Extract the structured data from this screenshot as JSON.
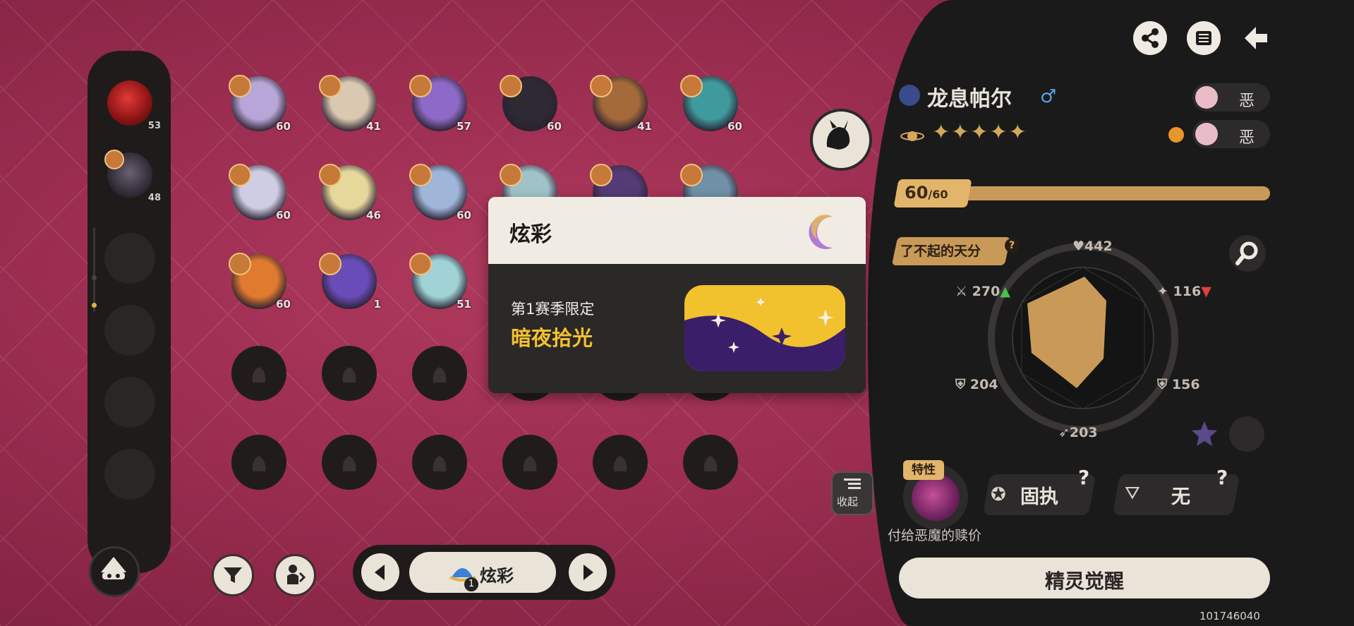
{
  "party": {
    "slots": [
      {
        "level": "53",
        "filled": true
      },
      {
        "level": "48",
        "filled": true
      },
      {
        "level": "",
        "filled": false
      },
      {
        "level": "",
        "filled": false
      },
      {
        "level": "",
        "filled": false
      },
      {
        "level": "",
        "filled": false
      }
    ]
  },
  "grid": {
    "items": [
      {
        "level": "60",
        "color": "#b9a6d8"
      },
      {
        "level": "41",
        "color": "#d9c9b0"
      },
      {
        "level": "57",
        "color": "#8d6ac7"
      },
      {
        "level": "60",
        "color": "#2e2a33"
      },
      {
        "level": "41",
        "color": "#a46a3a"
      },
      {
        "level": "60",
        "color": "#3f9a9e"
      },
      {
        "level": "60",
        "color": "#cfcde3"
      },
      {
        "level": "46",
        "color": "#e6d79b"
      },
      {
        "level": "60",
        "color": "#9fb6d9"
      },
      {
        "level": "",
        "color": "#9fd3d6"
      },
      {
        "level": "",
        "color": "#4b3c7a"
      },
      {
        "level": "",
        "color": "#6a9bb0"
      },
      {
        "level": "60",
        "color": "#e07a2f"
      },
      {
        "level": "1",
        "color": "#6a4cb8"
      },
      {
        "level": "51",
        "color": "#9fd3d6"
      }
    ]
  },
  "bottom_nav": {
    "filter_icon": "filter-icon",
    "center_label": "炫彩",
    "center_count": "1"
  },
  "popup": {
    "title": "炫彩",
    "season": "第1赛季限定",
    "name": "暗夜拾光"
  },
  "pet": {
    "name": "龙息帕尔",
    "gender": "♂",
    "type1": "恶",
    "type2": "恶",
    "star_count": 5,
    "level_current": "60",
    "level_max": "/60",
    "level_fraction": 1.0,
    "talent": "了不起的天分",
    "stats": {
      "hp": "442",
      "attack": "270",
      "sp_attack": "116",
      "defense": "204",
      "sp_defense": "156",
      "speed": "203"
    },
    "feature_tag": "特性",
    "nature": "固执",
    "ability_slot": "无",
    "ability_desc": "付给恶魔的赎价",
    "awaken_label": "精灵觉醒",
    "collapse_label": "收起"
  },
  "uid": "101746040",
  "colors": {
    "accent_gold": "#c99a57",
    "season_yellow": "#f5c12e",
    "panel_bg": "#1b1a1a"
  }
}
